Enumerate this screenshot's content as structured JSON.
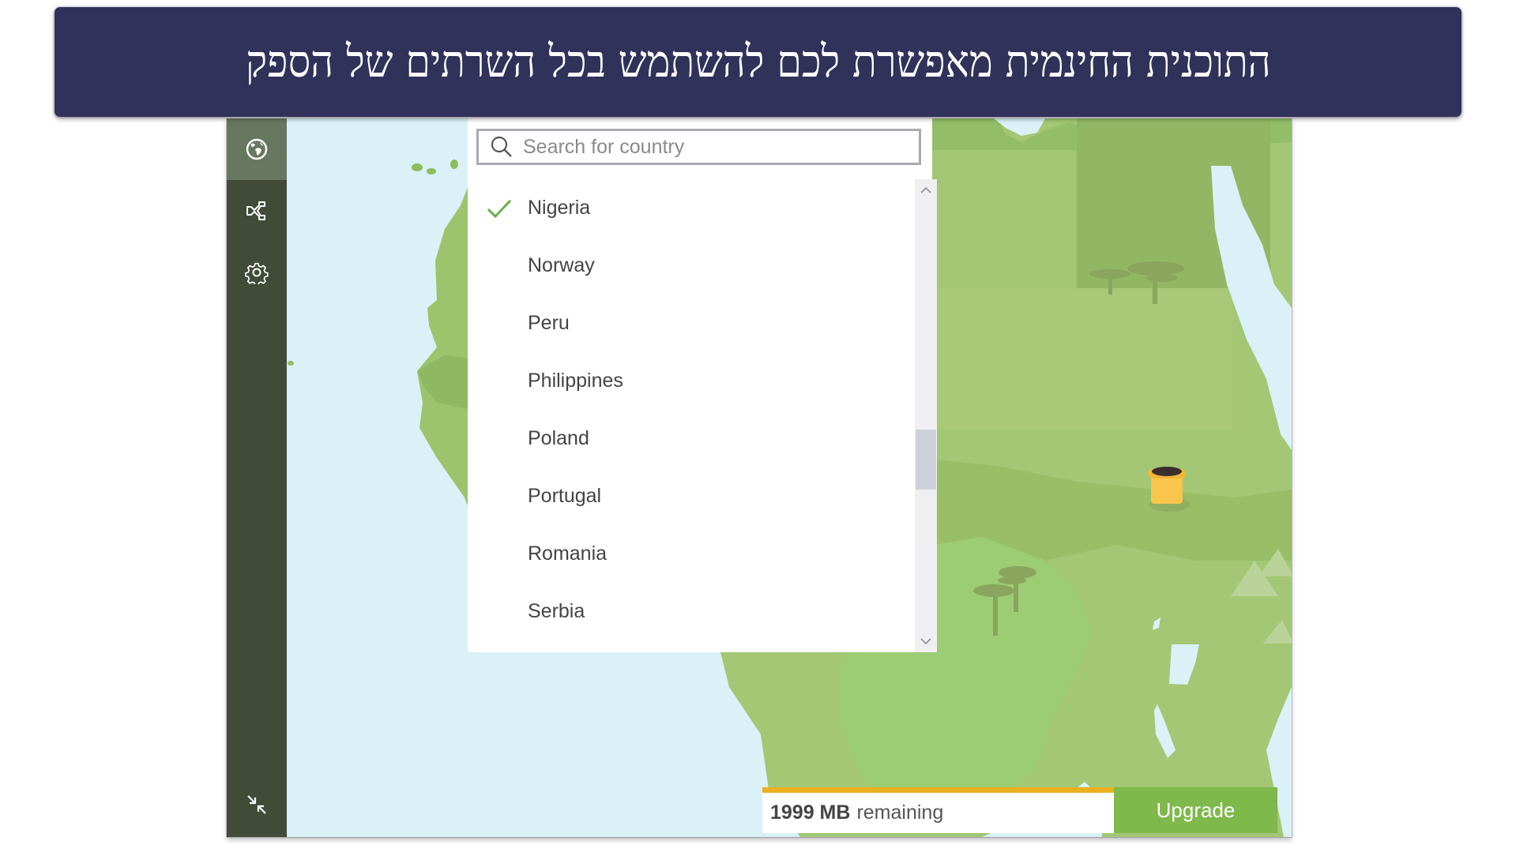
{
  "banner": {
    "title": "התוכנית החינמית מאפשרת לכם להשתמש בכל השרתים של הספק"
  },
  "sidebar": {
    "items": [
      {
        "name": "globe-icon",
        "label": "Map",
        "active": true
      },
      {
        "name": "share-network-icon",
        "label": "Share",
        "active": false
      },
      {
        "name": "gear-icon",
        "label": "Settings",
        "active": false
      }
    ],
    "bottom_icon": "collapse-icon"
  },
  "search": {
    "placeholder": "Search for country",
    "value": ""
  },
  "countries": [
    {
      "label": "Nigeria",
      "selected": true
    },
    {
      "label": "Norway",
      "selected": false
    },
    {
      "label": "Peru",
      "selected": false
    },
    {
      "label": "Philippines",
      "selected": false
    },
    {
      "label": "Poland",
      "selected": false
    },
    {
      "label": "Portugal",
      "selected": false
    },
    {
      "label": "Romania",
      "selected": false
    },
    {
      "label": "Serbia",
      "selected": false
    }
  ],
  "data_usage": {
    "amount": "1999 MB",
    "suffix": "remaining"
  },
  "upgrade": {
    "label": "Upgrade"
  },
  "colors": {
    "banner_bg": "#30325a",
    "sidebar_bg": "#414b38",
    "sidebar_active": "#687860",
    "ocean": "#d9f1f7",
    "land": "#9cc46c",
    "accent_green": "#7fb84b",
    "data_bar_accent": "#eab020",
    "check_green": "#6ab04c"
  }
}
